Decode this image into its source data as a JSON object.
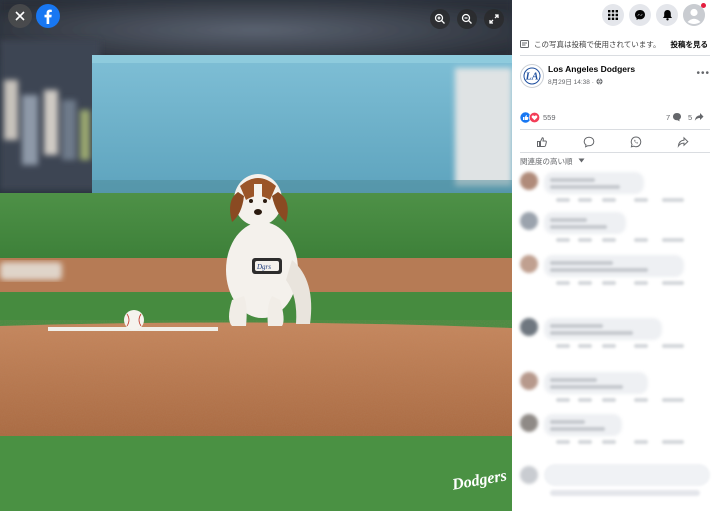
{
  "viewer": {
    "controls": [
      "close-icon",
      "facebook-logo-icon",
      "zoom-in-icon",
      "zoom-out-icon",
      "fullscreen-icon"
    ],
    "watermark": "Dodgers"
  },
  "topbar": {
    "icons": [
      "menu-grid-icon",
      "messenger-icon",
      "notifications-bell-icon",
      "account-avatar-icon"
    ],
    "notification_dot_color": "#e41e3f"
  },
  "notice": {
    "text": "この写真は投稿で使用されています。",
    "see_post": "投稿を見る"
  },
  "post": {
    "page_name": "Los Angeles Dodgers",
    "date": "8月29日 14:38 ·",
    "reaction_count": "559",
    "comment_count": "7",
    "share_count": "5"
  },
  "comments": {
    "sort_label": "関連度の高い順"
  },
  "colors": {
    "facebook_blue": "#1877f2",
    "like_blue": "#1877f2",
    "love_red": "#f33e58",
    "grass": "#3f8a3c",
    "dirt": "#b07450",
    "wall": "#6fb3cc"
  }
}
